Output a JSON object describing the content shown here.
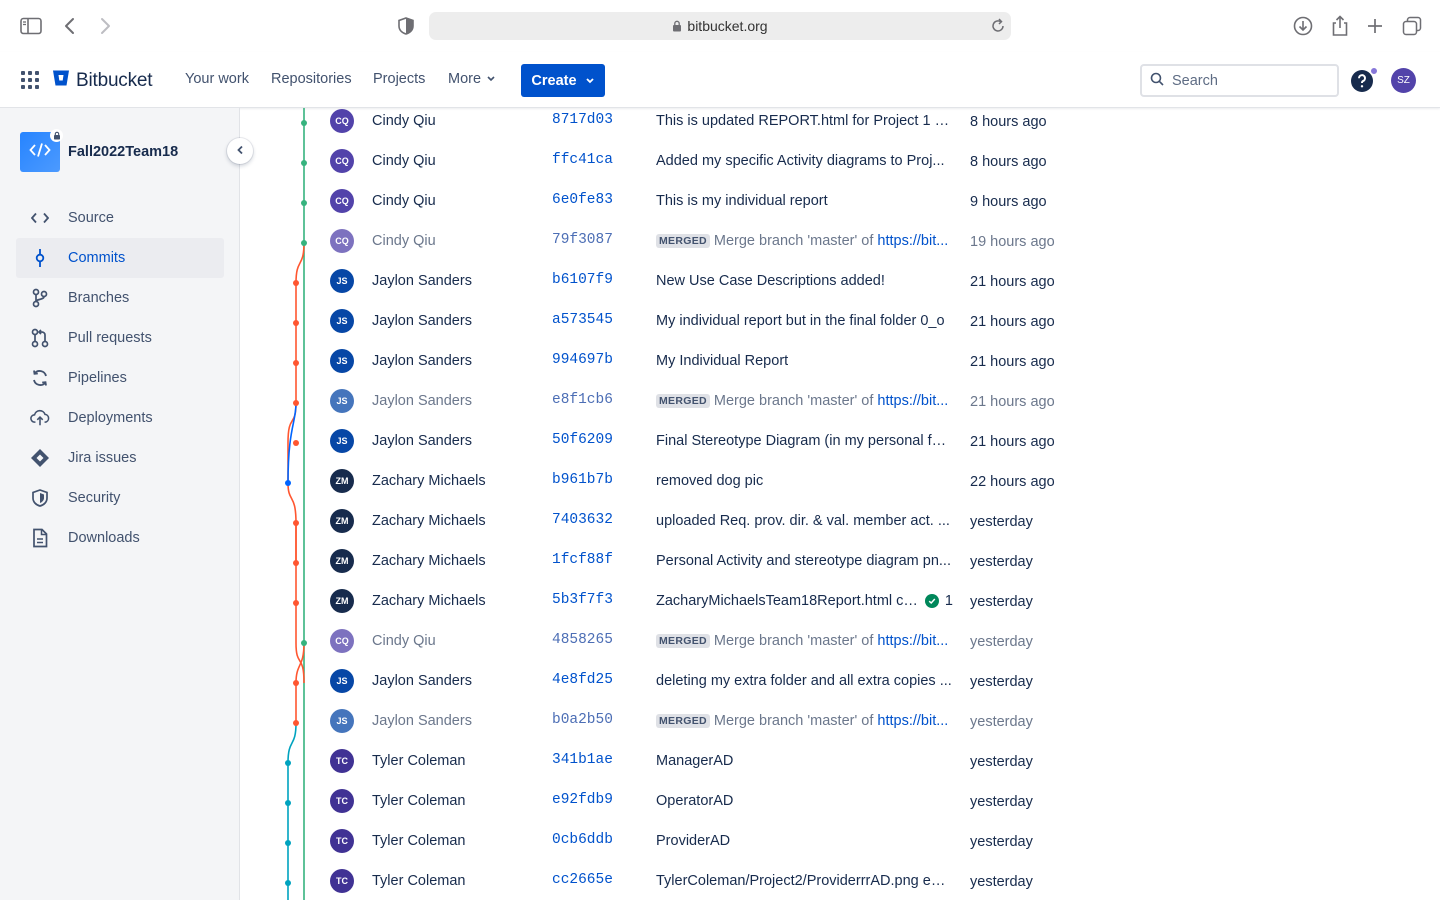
{
  "browser": {
    "url": "bitbucket.org"
  },
  "header": {
    "logo": "Bitbucket",
    "nav": [
      "Your work",
      "Repositories",
      "Projects",
      "More"
    ],
    "create_label": "Create",
    "search_placeholder": "Search",
    "user_initials": "SZ"
  },
  "sidebar": {
    "repo_name": "Fall2022Team18",
    "items": [
      {
        "label": "Source",
        "icon": "code-icon"
      },
      {
        "label": "Commits",
        "icon": "commit-icon",
        "active": true
      },
      {
        "label": "Branches",
        "icon": "branch-icon"
      },
      {
        "label": "Pull requests",
        "icon": "pull-request-icon"
      },
      {
        "label": "Pipelines",
        "icon": "pipelines-icon"
      },
      {
        "label": "Deployments",
        "icon": "cloud-upload-icon"
      },
      {
        "label": "Jira issues",
        "icon": "jira-icon"
      },
      {
        "label": "Security",
        "icon": "shield-icon"
      },
      {
        "label": "Downloads",
        "icon": "document-icon"
      }
    ]
  },
  "colors": {
    "accent": "#0052CC",
    "graph_green": "#36B37E",
    "graph_red": "#FF5630",
    "graph_blue": "#0065FF",
    "graph_cyan": "#00A3BF"
  },
  "commits": [
    {
      "initials": "CQ",
      "author": "Cindy Qiu",
      "hash": "8717d03",
      "message": "This is updated REPORT.html for Project 1 ",
      "message_em": "u...",
      "date": "8 hours ago",
      "avatar_color": "#5243AA",
      "lane": "green"
    },
    {
      "initials": "CQ",
      "author": "Cindy Qiu",
      "hash": "ffc41ca",
      "message": "Added my specific Activity diagrams to Proj...",
      "date": "8 hours ago",
      "avatar_color": "#5243AA",
      "lane": "green"
    },
    {
      "initials": "CQ",
      "author": "Cindy Qiu",
      "hash": "6e0fe83",
      "message": "This is my individual report",
      "date": "9 hours ago",
      "avatar_color": "#5243AA",
      "lane": "green"
    },
    {
      "initials": "CQ",
      "author": "Cindy Qiu",
      "hash": "79f3087",
      "merged": true,
      "merge_label": "MERGED",
      "message": "Merge branch 'master' of ",
      "link": "https://bit...",
      "date": "19 hours ago",
      "avatar_color": "#5243AA",
      "lane": "green"
    },
    {
      "initials": "JS",
      "author": "Jaylon Sanders",
      "hash": "b6107f9",
      "message": "New Use Case Descriptions added!",
      "date": "21 hours ago",
      "avatar_color": "#0747A6",
      "lane": "red"
    },
    {
      "initials": "JS",
      "author": "Jaylon Sanders",
      "hash": "a573545",
      "message": "My individual report but in the final folder 0_o",
      "date": "21 hours ago",
      "avatar_color": "#0747A6",
      "lane": "red"
    },
    {
      "initials": "JS",
      "author": "Jaylon Sanders",
      "hash": "994697b",
      "message": "My Individual Report",
      "date": "21 hours ago",
      "avatar_color": "#0747A6",
      "lane": "red"
    },
    {
      "initials": "JS",
      "author": "Jaylon Sanders",
      "hash": "e8f1cb6",
      "merged": true,
      "merge_label": "MERGED",
      "message": "Merge branch 'master' of ",
      "link": "https://bit...",
      "date": "21 hours ago",
      "avatar_color": "#0747A6",
      "lane": "red"
    },
    {
      "initials": "JS",
      "author": "Jaylon Sanders",
      "hash": "50f6209",
      "message": "Final Stereotype Diagram (in my personal fol...",
      "date": "21 hours ago",
      "avatar_color": "#0747A6",
      "lane": "red"
    },
    {
      "initials": "ZM",
      "author": "Zachary Michaels",
      "hash": "b961b7b",
      "message": "removed dog pic",
      "date": "22 hours ago",
      "avatar_color": "#172B4D",
      "lane": "blue"
    },
    {
      "initials": "ZM",
      "author": "Zachary Michaels",
      "hash": "7403632",
      "message": "uploaded Req. prov. dir. & val. member act. ...",
      "date": "yesterday",
      "avatar_color": "#172B4D",
      "lane": "red"
    },
    {
      "initials": "ZM",
      "author": "Zachary Michaels",
      "hash": "1fcf88f",
      "message": "Personal Activity and stereotype diagram pn...",
      "date": "yesterday",
      "avatar_color": "#172B4D",
      "lane": "red"
    },
    {
      "initials": "ZM",
      "author": "Zachary Michaels",
      "hash": "5b3f7f3",
      "message": "ZacharyMichaelsTeam18Report.html cre...",
      "build_count": "1",
      "date": "yesterday",
      "avatar_color": "#172B4D",
      "lane": "red"
    },
    {
      "initials": "CQ",
      "author": "Cindy Qiu",
      "hash": "4858265",
      "merged": true,
      "merge_label": "MERGED",
      "message": "Merge branch 'master' of ",
      "link": "https://bit...",
      "date": "yesterday",
      "avatar_color": "#5243AA",
      "lane": "green"
    },
    {
      "initials": "JS",
      "author": "Jaylon Sanders",
      "hash": "4e8fd25",
      "message": "deleting my extra folder and all extra copies ...",
      "date": "yesterday",
      "avatar_color": "#0747A6",
      "lane": "red"
    },
    {
      "initials": "JS",
      "author": "Jaylon Sanders",
      "hash": "b0a2b50",
      "merged": true,
      "merge_label": "MERGED",
      "message": "Merge branch 'master' of ",
      "link": "https://bit...",
      "date": "yesterday",
      "avatar_color": "#0747A6",
      "lane": "red"
    },
    {
      "initials": "TC",
      "author": "Tyler Coleman",
      "hash": "341b1ae",
      "message": "ManagerAD",
      "date": "yesterday",
      "avatar_color": "#403294",
      "lane": "cyan"
    },
    {
      "initials": "TC",
      "author": "Tyler Coleman",
      "hash": "e92fdb9",
      "message": "OperatorAD",
      "date": "yesterday",
      "avatar_color": "#403294",
      "lane": "cyan"
    },
    {
      "initials": "TC",
      "author": "Tyler Coleman",
      "hash": "0cb6ddb",
      "message": "ProviderAD",
      "date": "yesterday",
      "avatar_color": "#403294",
      "lane": "cyan"
    },
    {
      "initials": "TC",
      "author": "Tyler Coleman",
      "hash": "cc2665e",
      "message": "TylerColeman/Project2/ProviderrrAD.png edi...",
      "date": "yesterday",
      "avatar_color": "#403294",
      "lane": "cyan"
    }
  ]
}
